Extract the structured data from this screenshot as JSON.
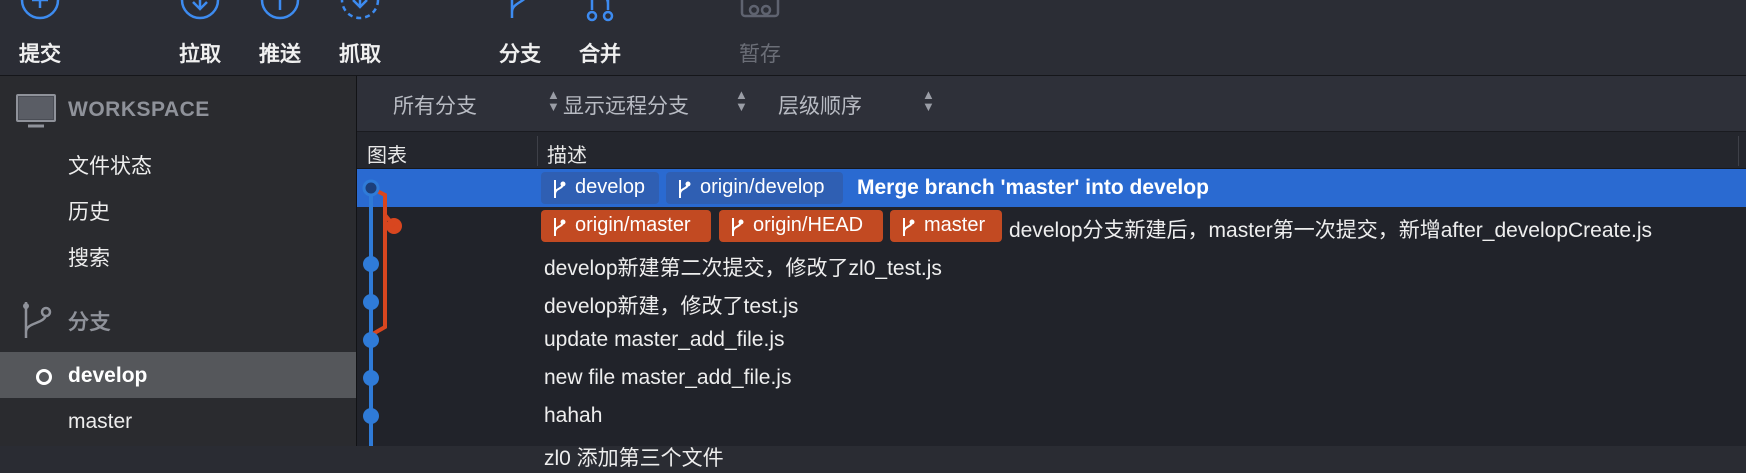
{
  "toolbar": {
    "commit": "提交",
    "pull": "拉取",
    "push": "推送",
    "fetch": "抓取",
    "branch": "分支",
    "merge": "合并",
    "stash": "暂存"
  },
  "sidebar": {
    "workspace": {
      "title": "WORKSPACE",
      "items": [
        "文件状态",
        "历史",
        "搜索"
      ]
    },
    "branches": {
      "title": "分支",
      "items": [
        {
          "label": "develop",
          "current": true
        },
        {
          "label": "master",
          "current": false
        }
      ]
    }
  },
  "filters": {
    "branches": "所有分支",
    "remote": "显示远程分支",
    "order": "层级顺序"
  },
  "columns": {
    "graph": "图表",
    "description": "描述"
  },
  "colors": {
    "accent": "#2a6ad1",
    "local_branch_tag": "#2f5fb3",
    "remote_branch_tag": "#c24a22",
    "graph_main": "#2f7bd8",
    "graph_branch": "#d8461f"
  },
  "commits": [
    {
      "tags": [
        {
          "label": "develop",
          "kind": "local"
        },
        {
          "label": "origin/develop",
          "kind": "remote-local"
        }
      ],
      "message": "Merge branch 'master' into develop",
      "selected": true
    },
    {
      "tags": [
        {
          "label": "origin/master",
          "kind": "remote"
        },
        {
          "label": "origin/HEAD",
          "kind": "remote"
        },
        {
          "label": "master",
          "kind": "remote"
        }
      ],
      "message": "develop分支新建后，master第一次提交，新增after_developCreate.js",
      "selected": false
    },
    {
      "tags": [],
      "message": "develop新建第二次提交，修改了zl0_test.js",
      "selected": false
    },
    {
      "tags": [],
      "message": "develop新建，修改了test.js",
      "selected": false
    },
    {
      "tags": [],
      "message": "update master_add_file.js",
      "selected": false
    },
    {
      "tags": [],
      "message": "new file master_add_file.js",
      "selected": false
    },
    {
      "tags": [],
      "message": "hahah",
      "selected": false
    },
    {
      "tags": [],
      "message": "zl0 添加第三个文件",
      "selected": false
    }
  ]
}
